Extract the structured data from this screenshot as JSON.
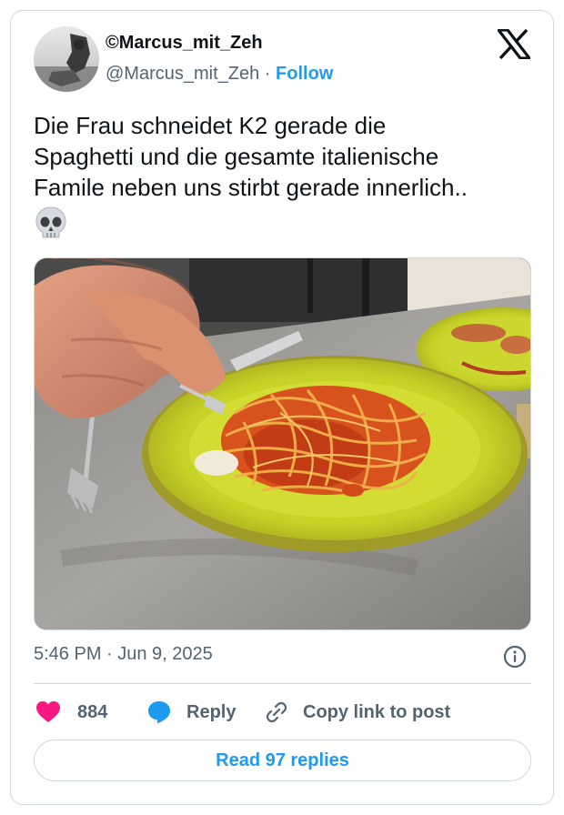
{
  "author": {
    "display_name": "©Marcus_mit_Zeh",
    "handle": "@Marcus_mit_Zeh",
    "separator": " · ",
    "follow_label": "Follow"
  },
  "tweet": {
    "text": "Die Frau schneidet K2 gerade die\nSpaghetti und die gesamte italienische\nFamile neben uns stirbt gerade innerlich..",
    "emoji": "skull-emoji",
    "media": "photo of a person cutting spaghetti with tomato sauce on a yellow-green plate with a knife and fork"
  },
  "meta": {
    "timestamp": "5:46 PM · Jun 9, 2025"
  },
  "actions": {
    "like_count": "884",
    "reply_label": "Reply",
    "copy_label": "Copy link to post"
  },
  "footer": {
    "read_replies_label": "Read 97 replies"
  },
  "colors": {
    "accent": "#1d9bf0",
    "like": "#f91880",
    "secondary_text": "#536471",
    "border": "#cfd9de"
  },
  "icons": [
    "x-logo-icon",
    "skull-emoji-icon",
    "info-icon",
    "heart-icon",
    "reply-bubble-icon",
    "link-icon"
  ]
}
